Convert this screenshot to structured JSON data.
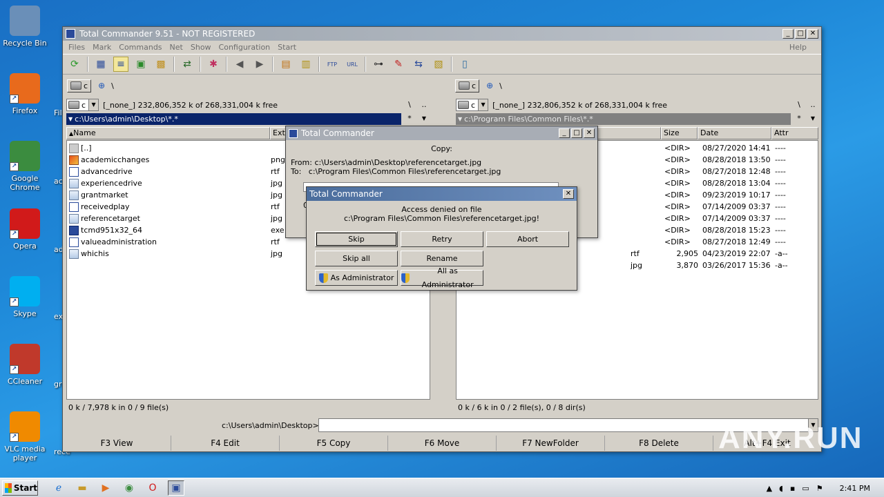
{
  "desktop": {
    "icons": [
      {
        "label": "Recycle Bin",
        "icon": "recycle-bin-icon",
        "color": "#6a8fb8"
      },
      {
        "label": "Firefox",
        "icon": "firefox-icon",
        "color": "#e86a1c"
      },
      {
        "label": "Google Chrome",
        "icon": "chrome-icon",
        "color": "#3b8c3f"
      },
      {
        "label": "Opera",
        "icon": "opera-icon",
        "color": "#d11a1a"
      },
      {
        "label": "Skype",
        "icon": "skype-icon",
        "color": "#00aff0"
      },
      {
        "label": "CCleaner",
        "icon": "ccleaner-icon",
        "color": "#c0392b"
      },
      {
        "label": "VLC media player",
        "icon": "vlc-icon",
        "color": "#f08a00"
      }
    ],
    "partial_labels": [
      "Fil",
      "aca",
      "adv",
      "exp",
      "gra",
      "rece"
    ]
  },
  "window": {
    "title": "Total Commander 9.51 - NOT REGISTERED",
    "menu": [
      "Files",
      "Mark",
      "Commands",
      "Net",
      "Show",
      "Configuration",
      "Start"
    ],
    "help": "Help"
  },
  "left": {
    "drive": "c",
    "root": "\\",
    "volume": "[_none_]",
    "free": "232,806,352 k of 268,331,004 k free",
    "path": "c:\\Users\\admin\\Desktop\\*.*",
    "col_name": "Name",
    "col_ext": "Ext",
    "files": [
      {
        "name": "[..]",
        "ext": "",
        "type": "up"
      },
      {
        "name": "academicchanges",
        "ext": "png",
        "type": "png"
      },
      {
        "name": "advancedrive",
        "ext": "rtf",
        "type": "doc"
      },
      {
        "name": "experiencedrive",
        "ext": "jpg",
        "type": "img"
      },
      {
        "name": "grantmarket",
        "ext": "jpg",
        "type": "img"
      },
      {
        "name": "receivedplay",
        "ext": "rtf",
        "type": "doc"
      },
      {
        "name": "referencetarget",
        "ext": "jpg",
        "type": "img"
      },
      {
        "name": "tcmd951x32_64",
        "ext": "exe",
        "type": "exe"
      },
      {
        "name": "valueadministration",
        "ext": "rtf",
        "type": "doc"
      },
      {
        "name": "whichis",
        "ext": "jpg",
        "type": "img"
      }
    ],
    "status": "0 k / 7,978 k in 0 / 9 file(s)"
  },
  "right": {
    "drive": "c",
    "root": "\\",
    "volume": "[_none_]",
    "free": "232,806,352 k of 268,331,004 k free",
    "path": "c:\\Program Files\\Common Files\\*.*",
    "col_ext": "Ext",
    "col_size": "Size",
    "col_date": "Date",
    "col_attr": "Attr",
    "rows": [
      {
        "ext": "",
        "size": "<DIR>",
        "date": "08/27/2020 14:41",
        "attr": "----"
      },
      {
        "ext": "",
        "size": "<DIR>",
        "date": "08/28/2018 13:50",
        "attr": "----"
      },
      {
        "ext": "",
        "size": "<DIR>",
        "date": "08/27/2018 12:48",
        "attr": "----"
      },
      {
        "ext": "",
        "size": "<DIR>",
        "date": "08/28/2018 13:04",
        "attr": "----"
      },
      {
        "ext": "",
        "size": "<DIR>",
        "date": "09/23/2019 10:17",
        "attr": "----"
      },
      {
        "ext": "",
        "size": "<DIR>",
        "date": "07/14/2009 03:37",
        "attr": "----"
      },
      {
        "ext": "",
        "size": "<DIR>",
        "date": "07/14/2009 03:37",
        "attr": "----"
      },
      {
        "ext": "",
        "size": "<DIR>",
        "date": "08/28/2018 15:23",
        "attr": "----"
      },
      {
        "ext": "",
        "size": "<DIR>",
        "date": "08/27/2018 12:49",
        "attr": "----"
      },
      {
        "ext": "rtf",
        "size": "2,905",
        "date": "04/23/2019 22:07",
        "attr": "-a--"
      },
      {
        "ext": "jpg",
        "size": "3,870",
        "date": "03/26/2017 15:36",
        "attr": "-a--"
      }
    ],
    "status": "0 k / 6 k in 0 / 2 file(s), 0 / 8 dir(s)"
  },
  "cmdline": {
    "label": "c:\\Users\\admin\\Desktop>"
  },
  "fkeys": [
    "F3 View",
    "F4 Edit",
    "F5 Copy",
    "F6 Move",
    "F7 NewFolder",
    "F8 Delete",
    "Alt+F4 Exit"
  ],
  "copy_dialog": {
    "title": "Total Commander",
    "heading": "Copy:",
    "from": "From: c:\\Users\\admin\\Desktop\\referencetarget.jpg",
    "to": "To:   c:\\Program Files\\Common Files\\referencetarget.jpg",
    "progress_fraction": 0,
    "zero_label": "0"
  },
  "error_dialog": {
    "title": "Total Commander",
    "line1": "Access denied on file",
    "line2": "c:\\Program Files\\Common Files\\referencetarget.jpg!",
    "buttons": {
      "skip": "Skip",
      "retry": "Retry",
      "abort": "Abort",
      "skip_all": "Skip all",
      "rename": "Rename",
      "as_admin": "As Administrator",
      "all_as_admin": "All as Administrator"
    }
  },
  "taskbar": {
    "start": "Start",
    "clock": "2:41 PM"
  },
  "watermark": "ANY.RUN"
}
